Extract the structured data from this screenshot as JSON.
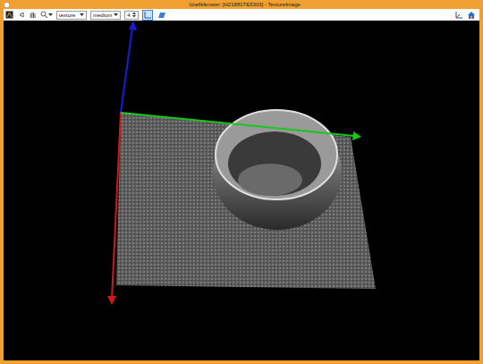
{
  "window": {
    "title": "Grafikfenster: [H21881TE5303] - TextureImage"
  },
  "toolbar": {
    "dropdowns": [
      {
        "name": "display-mode",
        "value": "texture"
      },
      {
        "name": "quality",
        "value": "medium"
      }
    ],
    "spinner": {
      "value": "4"
    },
    "view_buttons": [
      {
        "name": "axes",
        "selected": true
      },
      {
        "name": "plane",
        "selected": false
      }
    ]
  },
  "scene": {
    "axes": [
      {
        "name": "z",
        "color": "#1a1ad8"
      },
      {
        "name": "x",
        "color": "#d01818"
      },
      {
        "name": "y",
        "color": "#18c818"
      }
    ]
  }
}
